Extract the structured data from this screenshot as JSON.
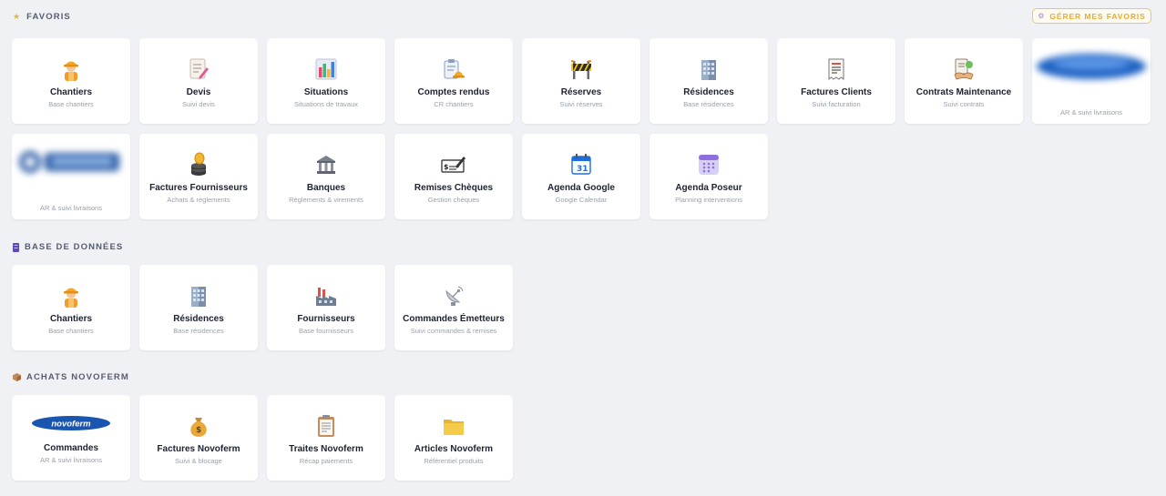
{
  "header": {
    "favoris_title": "FAVORIS",
    "manage_label": "GÉRER MES FAVORIS"
  },
  "favoris": [
    {
      "title": "Chantiers",
      "sub": "Base chantiers",
      "icon": "construction-worker-icon"
    },
    {
      "title": "Devis",
      "sub": "Suivi devis",
      "icon": "memo-icon"
    },
    {
      "title": "Situations",
      "sub": "Situations de travaux",
      "icon": "bar-chart-icon"
    },
    {
      "title": "Comptes rendus",
      "sub": "CR chantiers",
      "icon": "clipboard-hardhat-icon"
    },
    {
      "title": "Réserves",
      "sub": "Suivi réserves",
      "icon": "construction-barrier-icon"
    },
    {
      "title": "Résidences",
      "sub": "Base résidences",
      "icon": "office-building-icon"
    },
    {
      "title": "Factures Clients",
      "sub": "Suivi facturation",
      "icon": "receipt-icon"
    },
    {
      "title": "Contrats Maintenance",
      "sub": "Suivi contrats",
      "icon": "handshake-contract-icon"
    },
    {
      "title": "",
      "sub": "AR & suivi livraisons",
      "icon": "blurred-supplier-logo"
    },
    {
      "title": "",
      "sub": "AR & suivi livraisons",
      "icon": "blurred-supplier-logo"
    },
    {
      "title": "Factures Fournisseurs",
      "sub": "Achats & règlements",
      "icon": "coin-stack-icon"
    },
    {
      "title": "Banques",
      "sub": "Règlements & virements",
      "icon": "bank-icon"
    },
    {
      "title": "Remises Chèques",
      "sub": "Gestion chèques",
      "icon": "cheque-icon"
    },
    {
      "title": "Agenda Google",
      "sub": "Google Calendar",
      "icon": "calendar-icon"
    },
    {
      "title": "Agenda Poseur",
      "sub": "Planning interventions",
      "icon": "planning-calendar-icon"
    }
  ],
  "bdd": {
    "title": "BASE DE DONNÉES",
    "items": [
      {
        "title": "Chantiers",
        "sub": "Base chantiers",
        "icon": "construction-worker-icon"
      },
      {
        "title": "Résidences",
        "sub": "Base résidences",
        "icon": "office-building-icon"
      },
      {
        "title": "Fournisseurs",
        "sub": "Base fournisseurs",
        "icon": "factory-icon"
      },
      {
        "title": "Commandes Émetteurs",
        "sub": "Suivi commandes & remises",
        "icon": "satellite-antenna-icon"
      }
    ]
  },
  "novoferm": {
    "title": "ACHATS NOVOFERM",
    "logo_text": "novoferm",
    "items": [
      {
        "title": "Commandes",
        "sub": "AR & suivi livraisons",
        "icon": "novoferm-logo"
      },
      {
        "title": "Factures Novoferm",
        "sub": "Suivi & blocage",
        "icon": "money-bag-icon"
      },
      {
        "title": "Traites Novoferm",
        "sub": "Récap paiements",
        "icon": "clipboard-icon"
      },
      {
        "title": "Articles Novoferm",
        "sub": "Référentiel produits",
        "icon": "folder-icon"
      }
    ]
  },
  "colors": {
    "background": "#f0f1f5",
    "accent": "#e2ad3c",
    "novoferm_blue": "#1a56b0"
  }
}
